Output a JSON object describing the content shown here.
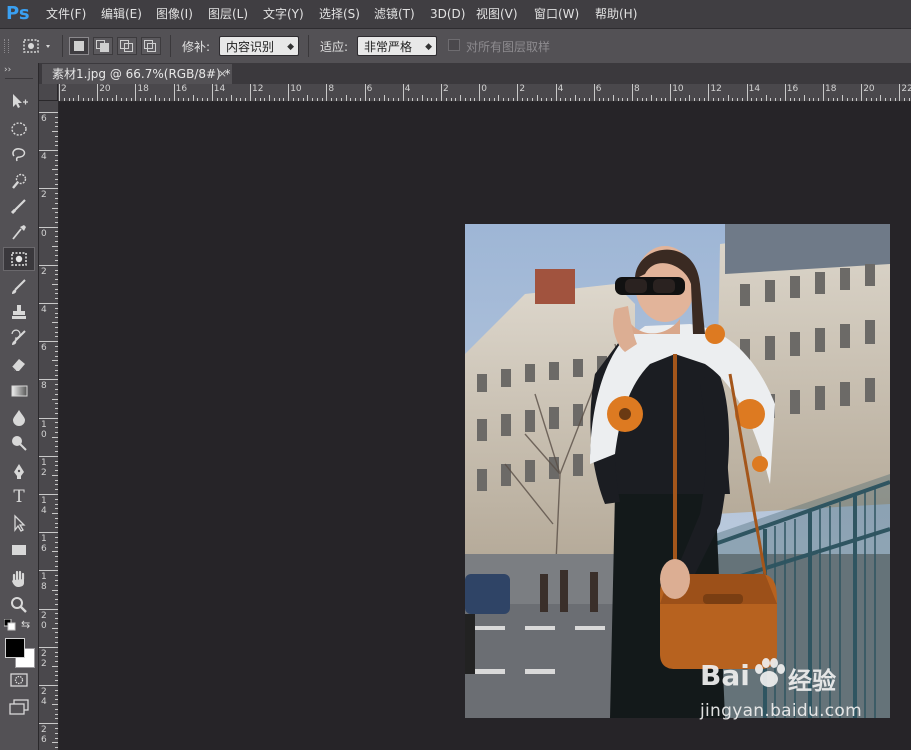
{
  "app": {
    "logo": "Ps"
  },
  "menu": [
    "文件(F)",
    "编辑(E)",
    "图像(I)",
    "图层(L)",
    "文字(Y)",
    "选择(S)",
    "滤镜(T)",
    "3D(D)",
    "视图(V)",
    "窗口(W)",
    "帮助(H)"
  ],
  "options": {
    "patch_label": "修补:",
    "patch_value": "内容识别",
    "adapt_label": "适应:",
    "adapt_value": "非常严格",
    "sample_all_label": "对所有图层取样",
    "sample_all_checked": false
  },
  "document_tab": {
    "title": "素材1.jpg @ 66.7%(RGB/8#) *",
    "close": "×"
  },
  "rulers": {
    "horizontal": [
      "2",
      "20",
      "18",
      "16",
      "14",
      "12",
      "10",
      "8",
      "6",
      "4",
      "2",
      "0",
      "2",
      "4",
      "6",
      "8",
      "10",
      "12",
      "14",
      "16",
      "18",
      "20",
      "22"
    ],
    "vertical": [
      "6",
      "4",
      "2",
      "0",
      "2",
      "4",
      "6",
      "8",
      "10",
      "12",
      "14",
      "16",
      "18",
      "20",
      "22",
      "24",
      "26"
    ]
  },
  "tools": [
    "move-tool",
    "elliptical-marquee-tool",
    "lasso-tool",
    "quick-selection-tool",
    "crop-tool",
    "eyedropper-tool",
    "patch-tool",
    "brush-tool",
    "clone-stamp-tool",
    "history-brush-tool",
    "eraser-tool",
    "gradient-tool",
    "blur-tool",
    "dodge-tool",
    "pen-tool",
    "type-tool",
    "path-selection-tool",
    "rectangle-tool",
    "hand-tool",
    "zoom-tool"
  ],
  "colors": {
    "foreground": "#000000",
    "background": "#ffffff"
  },
  "watermark": {
    "brand": "Bai",
    "brand_suffix": "经验",
    "url": "jingyan.baidu.com"
  }
}
